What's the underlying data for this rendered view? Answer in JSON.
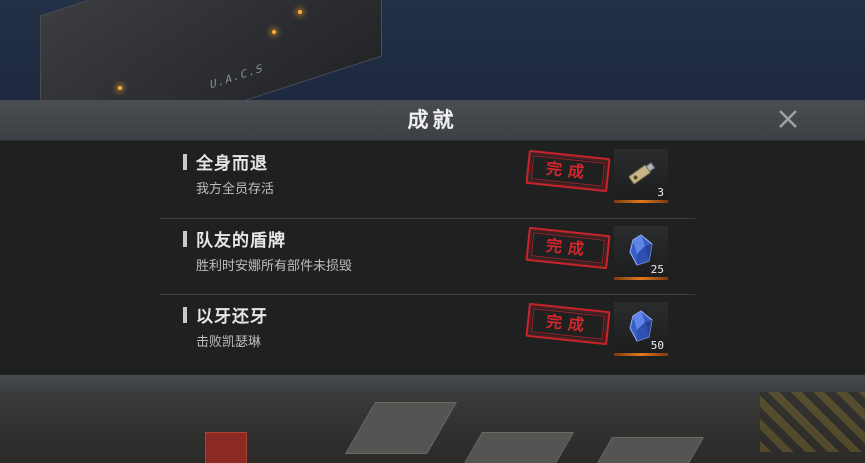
{
  "dialog": {
    "title": "成就"
  },
  "background": {
    "building_sign": "U.A.C.S"
  },
  "achievements": [
    {
      "title": "全身而退",
      "description": "我方全员存活",
      "status": "完成",
      "reward_icon": "usb-drive-icon",
      "reward_count": "3"
    },
    {
      "title": "队友的盾牌",
      "description": "胜利时安娜所有部件未损毁",
      "status": "完成",
      "reward_icon": "blue-crystal-icon",
      "reward_count": "25"
    },
    {
      "title": "以牙还牙",
      "description": "击败凯瑟琳",
      "status": "完成",
      "reward_icon": "blue-crystal-icon",
      "reward_count": "50"
    }
  ],
  "colors": {
    "stamp_red": "#d2262d",
    "header_bg": "#43474b",
    "panel_bg": "#1f2121",
    "reward_accent": "#e07a20"
  }
}
